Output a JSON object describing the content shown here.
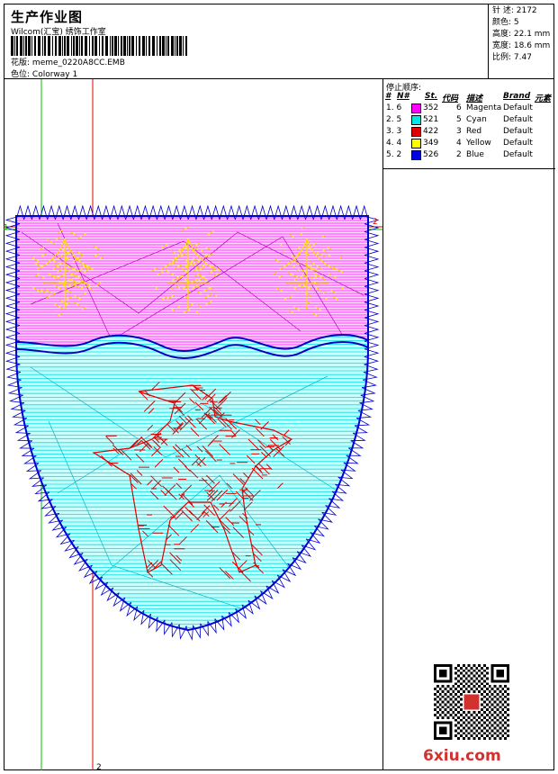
{
  "header": {
    "title": "生产作业图",
    "studio": "Wilcom(汇宝) 绣饰工作室",
    "design_label": "花版:",
    "design_file": "meme_0220A8CC.EMB",
    "colorway_label": "色位:",
    "colorway": "Colorway 1"
  },
  "stats": {
    "stitches": "针 述: 2172",
    "colors": "颜色: 5",
    "height": "高度: 22.1 mm",
    "width": "宽度: 18.6 mm",
    "scale": "比例: 7.47"
  },
  "stop_sequence": {
    "title": "停止顺序:",
    "headers": [
      "#",
      "N#",
      "St.",
      "代码",
      "描述",
      "Brand",
      "元素"
    ],
    "rows": [
      {
        "index": "1. 6",
        "code": "352",
        "num": "6",
        "desc": "Magenta",
        "brand": "Default",
        "color": "#ff00ff"
      },
      {
        "index": "2. 5",
        "code": "521",
        "num": "5",
        "desc": "Cyan",
        "brand": "Default",
        "color": "#00e8e8"
      },
      {
        "index": "3. 3",
        "code": "422",
        "num": "3",
        "desc": "Red",
        "brand": "Default",
        "color": "#e00000"
      },
      {
        "index": "4. 4",
        "code": "349",
        "num": "4",
        "desc": "Yellow",
        "brand": "Default",
        "color": "#ffff00"
      },
      {
        "index": "5. 2",
        "code": "526",
        "num": "2",
        "desc": "Blue",
        "brand": "Default",
        "color": "#0000e0"
      }
    ]
  },
  "guides": {
    "bottom_marker": "2",
    "right_marker": "2",
    "left_marker": "1"
  },
  "watermark": "6xiu.com"
}
